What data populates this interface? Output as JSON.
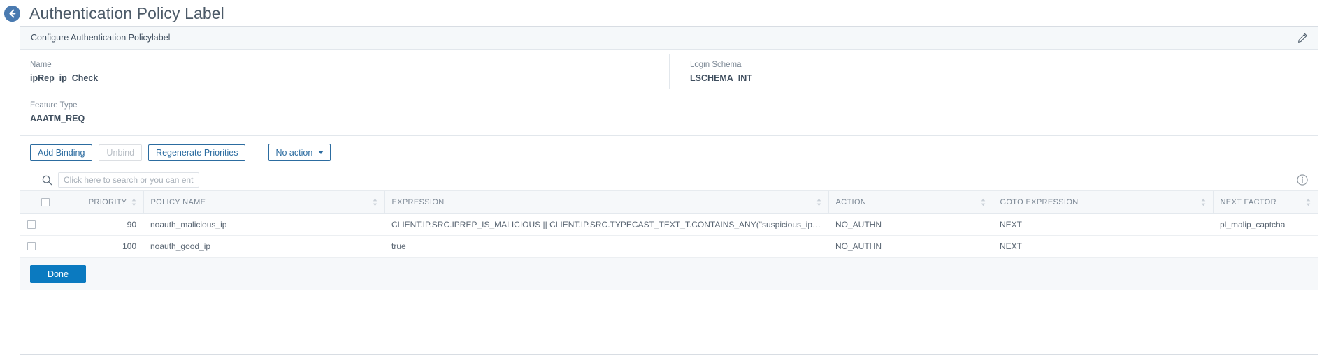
{
  "header": {
    "back_icon": "arrow-left-circle-icon",
    "title": "Authentication Policy Label"
  },
  "card": {
    "title": "Configure Authentication Policylabel",
    "edit_icon": "pencil-icon"
  },
  "details": {
    "name_label": "Name",
    "name_value": "ipRep_ip_Check",
    "login_schema_label": "Login Schema",
    "login_schema_value": "LSCHEMA_INT",
    "feature_type_label": "Feature Type",
    "feature_type_value": "AAATM_REQ"
  },
  "toolbar": {
    "add_binding_label": "Add Binding",
    "unbind_label": "Unbind",
    "regenerate_label": "Regenerate Priorities",
    "action_select_value": "No action"
  },
  "search": {
    "icon": "search-icon",
    "placeholder": "Click here to search or you can ent",
    "value": "",
    "info_icon": "info-circle-icon"
  },
  "table": {
    "columns": [
      "PRIORITY",
      "POLICY NAME",
      "EXPRESSION",
      "ACTION",
      "GOTO EXPRESSION",
      "NEXT FACTOR"
    ],
    "rows": [
      {
        "priority": "90",
        "policy_name": "noauth_malicious_ip",
        "expression": "CLIENT.IP.SRC.IPREP_IS_MALICIOUS || CLIENT.IP.SRC.TYPECAST_TEXT_T.CONTAINS_ANY(\"suspicious_ips\")",
        "action": "NO_AUTHN",
        "goto_expression": "NEXT",
        "next_factor": "pl_malip_captcha"
      },
      {
        "priority": "100",
        "policy_name": "noauth_good_ip",
        "expression": "true",
        "action": "NO_AUTHN",
        "goto_expression": "NEXT",
        "next_factor": ""
      }
    ]
  },
  "footer": {
    "done_label": "Done"
  },
  "colors": {
    "accent": "#0b7ac0",
    "link": "#2c6ca0",
    "header_bg": "#f5f8fa"
  }
}
